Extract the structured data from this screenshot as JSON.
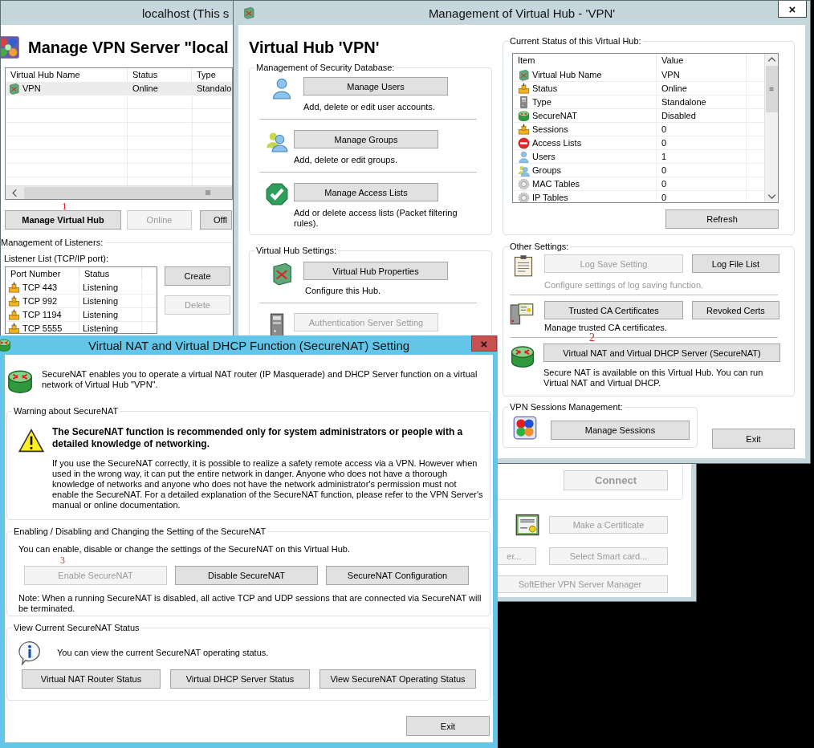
{
  "back_window": {
    "title": "localhost (This s",
    "heading": "Manage VPN Server \"local",
    "hub_table": {
      "columns": [
        "Virtual Hub Name",
        "Status",
        "Type"
      ],
      "rows": [
        {
          "cells": [
            "VPN",
            "Online",
            "Standalo"
          ],
          "selected": true
        }
      ]
    },
    "hub_buttons": [
      {
        "label": "Manage Virtual Hub",
        "disabled": false
      },
      {
        "label": "Online",
        "disabled": true
      },
      {
        "label": "Offl",
        "disabled": false
      }
    ],
    "listeners_legend": "Management of Listeners:",
    "listener_list_label": "Listener List (TCP/IP port):",
    "listener_table": {
      "columns": [
        "Port Number",
        "Status"
      ],
      "rows": [
        [
          "TCP 443",
          "Listening"
        ],
        [
          "TCP 992",
          "Listening"
        ],
        [
          "TCP 1194",
          "Listening"
        ],
        [
          "TCP 5555",
          "Listening"
        ]
      ]
    },
    "listener_buttons": [
      {
        "label": "Create",
        "disabled": false
      },
      {
        "label": "Delete",
        "disabled": true
      }
    ],
    "annotation": "1",
    "lower_buttons": [
      {
        "label": "Connect",
        "disabled": true
      },
      {
        "label": "Make a Certificate",
        "disabled": true
      },
      {
        "label": "er...",
        "disabled": true
      },
      {
        "label": "Select Smart card...",
        "disabled": true
      },
      {
        "label": "SoftEther VPN Server Manager",
        "disabled": true
      }
    ]
  },
  "hub_window": {
    "title": "Management of Virtual Hub - 'VPN'",
    "close_button": "×",
    "heading": "Virtual Hub 'VPN'",
    "security_group": {
      "legend": "Management of Security Database:",
      "items": [
        {
          "button": {
            "label": "Manage Users",
            "disabled": false
          },
          "description": "Add, delete or edit user accounts."
        },
        {
          "button": {
            "label": "Manage Groups",
            "disabled": false
          },
          "description": "Add, delete or edit groups."
        },
        {
          "button": {
            "label": "Manage Access Lists",
            "disabled": false
          },
          "description": "Add or delete access lists (Packet filtering rules)."
        }
      ]
    },
    "settings_group": {
      "legend": "Virtual Hub Settings:",
      "items": [
        {
          "button": {
            "label": "Virtual Hub Properties",
            "disabled": false
          },
          "description": "Configure this Hub."
        },
        {
          "button": {
            "label": "Authentication Server Setting",
            "disabled": true
          }
        }
      ]
    },
    "status_group": {
      "legend": "Current Status of this Virtual Hub:",
      "columns": [
        "Item",
        "Value"
      ],
      "rows": [
        [
          "Virtual Hub Name",
          "VPN"
        ],
        [
          "Status",
          "Online"
        ],
        [
          "Type",
          "Standalone"
        ],
        [
          "SecureNAT",
          "Disabled"
        ],
        [
          "Sessions",
          "0"
        ],
        [
          "Access Lists",
          "0"
        ],
        [
          "Users",
          "1"
        ],
        [
          "Groups",
          "0"
        ],
        [
          "MAC Tables",
          "0"
        ],
        [
          "IP Tables",
          "0"
        ]
      ],
      "refresh_button": "Refresh"
    },
    "other_group": {
      "legend": "Other Settings:",
      "rows": [
        {
          "buttons": [
            {
              "label": "Log Save Setting",
              "disabled": true
            },
            {
              "label": "Log File List",
              "disabled": false
            }
          ],
          "description": "Configure settings of log saving function.",
          "description_disabled": true
        },
        {
          "buttons": [
            {
              "label": "Trusted CA Certificates",
              "disabled": false
            },
            {
              "label": "Revoked Certs",
              "disabled": false
            }
          ],
          "description": "Manage trusted CA certificates.",
          "description_disabled": false
        },
        {
          "buttons": [
            {
              "label": "Virtual NAT and Virtual DHCP Server (SecureNAT)",
              "disabled": false
            }
          ],
          "description": "Secure NAT is available on this Virtual Hub. You can run Virtual NAT and Virtual DHCP.",
          "description_disabled": false
        }
      ]
    },
    "sessions_group": {
      "legend": "VPN Sessions Management:",
      "button": "Manage Sessions"
    },
    "exit_button": "Exit",
    "annotation": "2"
  },
  "dialog": {
    "title": "Virtual NAT and Virtual DHCP Function (SecureNAT) Setting",
    "close_button": "×",
    "intro": "SecureNAT enables you to operate a virtual NAT router (IP Masquerade) and DHCP Server function on a virtual network of Virtual Hub \"VPN\".",
    "warning_group": {
      "legend": "Warning about SecureNAT",
      "heading": "The SecureNAT function is recommended only for system administrators or people with a detailed knowledge of networking.",
      "body": "If you use the SecureNAT correctly, it is possible to realize a safety remote access via a VPN. However when used in the wrong way, it can put the entire network in danger. Anyone who does not have a thorough knowledge of networks and anyone who does not have the network administrator's permission must not enable the SecureNAT. For a detailed explanation of the SecureNAT function, please refer to the VPN Server's manual or online documentation."
    },
    "enable_group": {
      "legend": "Enabling / Disabling and Changing the Setting of the SecureNAT",
      "text": "You can enable, disable or change the settings of the SecureNAT on this Virtual Hub.",
      "buttons": [
        {
          "label": "Enable SecureNAT",
          "disabled": true
        },
        {
          "label": "Disable SecureNAT",
          "disabled": false
        },
        {
          "label": "SecureNAT Configuration",
          "disabled": false
        }
      ],
      "note": "Note: When a running SecureNAT is disabled, all active TCP and UDP sessions that are connected via SecureNAT will be terminated."
    },
    "annotation": "3",
    "status_group": {
      "legend": "View Current SecureNAT Status",
      "text": "You can view the current SecureNAT operating status.",
      "buttons": [
        {
          "label": "Virtual NAT Router Status",
          "disabled": false
        },
        {
          "label": "Virtual DHCP Server Status",
          "disabled": false
        },
        {
          "label": "View SecureNAT Operating Status",
          "disabled": false
        }
      ]
    },
    "exit_button": "Exit"
  }
}
